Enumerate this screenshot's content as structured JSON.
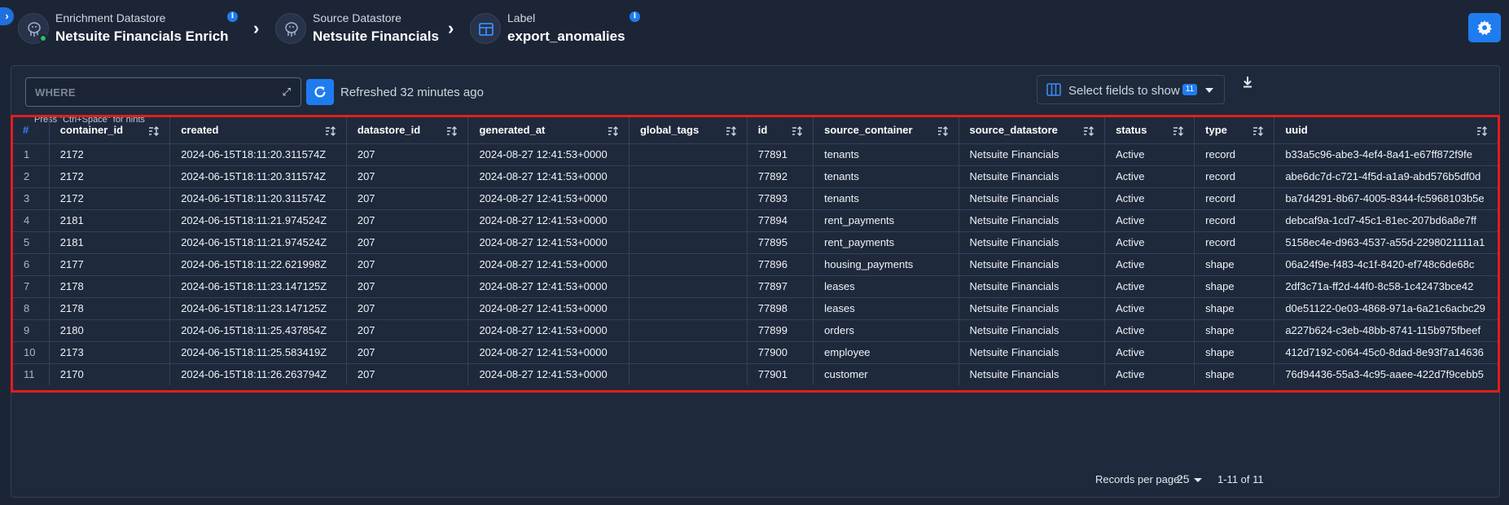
{
  "breadcrumb": [
    {
      "label": "Enrichment Datastore",
      "value": "Netsuite Financials Enrich",
      "icon": "postgres-icon",
      "status": "online"
    },
    {
      "label": "Source Datastore",
      "value": "Netsuite Financials",
      "icon": "postgres-icon"
    },
    {
      "label": "Label",
      "value": "export_anomalies",
      "icon": "table-icon"
    }
  ],
  "colors": {
    "accent": "#1f7cf0",
    "highlight_border": "#e11d1d",
    "online": "#22c55e"
  },
  "query": {
    "placeholder": "WHERE",
    "hint": "Press \"Ctrl+Space\" for hints"
  },
  "refreshed": "Refreshed 32 minutes ago",
  "fields_select": {
    "label": "Select fields to show",
    "count": "11"
  },
  "table": {
    "columns": [
      "#",
      "container_id",
      "created",
      "datastore_id",
      "generated_at",
      "global_tags",
      "id",
      "source_container",
      "source_datastore",
      "status",
      "type",
      "uuid"
    ],
    "rows": [
      [
        "1",
        "2172",
        "2024-06-15T18:11:20.311574Z",
        "207",
        "2024-08-27 12:41:53+0000",
        "",
        "77891",
        "tenants",
        "Netsuite Financials",
        "Active",
        "record",
        "b33a5c96-abe3-4ef4-8a41-e67ff872f9fe"
      ],
      [
        "2",
        "2172",
        "2024-06-15T18:11:20.311574Z",
        "207",
        "2024-08-27 12:41:53+0000",
        "",
        "77892",
        "tenants",
        "Netsuite Financials",
        "Active",
        "record",
        "abe6dc7d-c721-4f5d-a1a9-abd576b5df0d"
      ],
      [
        "3",
        "2172",
        "2024-06-15T18:11:20.311574Z",
        "207",
        "2024-08-27 12:41:53+0000",
        "",
        "77893",
        "tenants",
        "Netsuite Financials",
        "Active",
        "record",
        "ba7d4291-8b67-4005-8344-fc5968103b5e"
      ],
      [
        "4",
        "2181",
        "2024-06-15T18:11:21.974524Z",
        "207",
        "2024-08-27 12:41:53+0000",
        "",
        "77894",
        "rent_payments",
        "Netsuite Financials",
        "Active",
        "record",
        "debcaf9a-1cd7-45c1-81ec-207bd6a8e7ff"
      ],
      [
        "5",
        "2181",
        "2024-06-15T18:11:21.974524Z",
        "207",
        "2024-08-27 12:41:53+0000",
        "",
        "77895",
        "rent_payments",
        "Netsuite Financials",
        "Active",
        "record",
        "5158ec4e-d963-4537-a55d-2298021111a1"
      ],
      [
        "6",
        "2177",
        "2024-06-15T18:11:22.621998Z",
        "207",
        "2024-08-27 12:41:53+0000",
        "",
        "77896",
        "housing_payments",
        "Netsuite Financials",
        "Active",
        "shape",
        "06a24f9e-f483-4c1f-8420-ef748c6de68c"
      ],
      [
        "7",
        "2178",
        "2024-06-15T18:11:23.147125Z",
        "207",
        "2024-08-27 12:41:53+0000",
        "",
        "77897",
        "leases",
        "Netsuite Financials",
        "Active",
        "shape",
        "2df3c71a-ff2d-44f0-8c58-1c42473bce42"
      ],
      [
        "8",
        "2178",
        "2024-06-15T18:11:23.147125Z",
        "207",
        "2024-08-27 12:41:53+0000",
        "",
        "77898",
        "leases",
        "Netsuite Financials",
        "Active",
        "shape",
        "d0e51122-0e03-4868-971a-6a21c6acbc29"
      ],
      [
        "9",
        "2180",
        "2024-06-15T18:11:25.437854Z",
        "207",
        "2024-08-27 12:41:53+0000",
        "",
        "77899",
        "orders",
        "Netsuite Financials",
        "Active",
        "shape",
        "a227b624-c3eb-48bb-8741-115b975fbeef"
      ],
      [
        "10",
        "2173",
        "2024-06-15T18:11:25.583419Z",
        "207",
        "2024-08-27 12:41:53+0000",
        "",
        "77900",
        "employee",
        "Netsuite Financials",
        "Active",
        "shape",
        "412d7192-c064-45c0-8dad-8e93f7a14636"
      ],
      [
        "11",
        "2170",
        "2024-06-15T18:11:26.263794Z",
        "207",
        "2024-08-27 12:41:53+0000",
        "",
        "77901",
        "customer",
        "Netsuite Financials",
        "Active",
        "shape",
        "76d94436-55a3-4c95-aaee-422d7f9cebb5"
      ]
    ]
  },
  "pagination": {
    "rows_per_page_label": "Records per page:",
    "rows_per_page": "25",
    "range": "1-11 of 11"
  }
}
